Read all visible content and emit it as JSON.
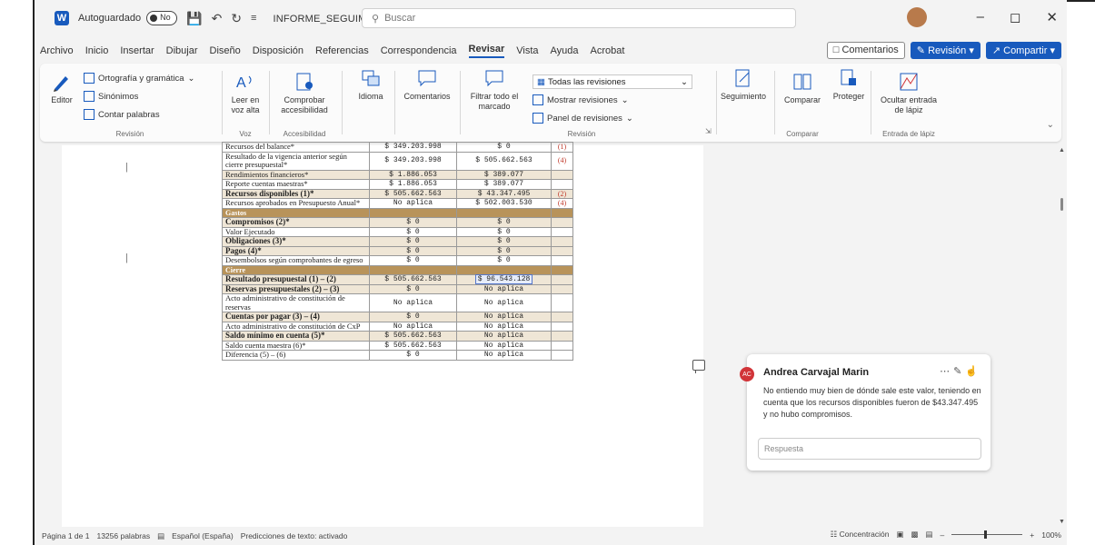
{
  "titlebar": {
    "autosave_label": "Autoguardado",
    "autosave_state": "No",
    "doc_title": "INFORME_SEGUIMIENTO_LA_MACARENA_V... ∨",
    "search_placeholder": "Buscar"
  },
  "menu": {
    "items": [
      "Archivo",
      "Inicio",
      "Insertar",
      "Dibujar",
      "Diseño",
      "Disposición",
      "Referencias",
      "Correspondencia",
      "Revisar",
      "Vista",
      "Ayuda",
      "Acrobat"
    ],
    "comentarios": "Comentarios",
    "revision": "Revisión",
    "compartir": "Compartir"
  },
  "ribbon": {
    "editor": "Editor",
    "ortografia": "Ortografía y gramática",
    "sinonimos": "Sinónimos",
    "contar": "Contar palabras",
    "group_revision": "Revisión",
    "leer": "Leer en voz alta",
    "group_voz": "Voz",
    "comprobar": "Comprobar accesibilidad",
    "group_accesibilidad": "Accesibilidad",
    "idioma": "Idioma",
    "comentarios": "Comentarios",
    "seguir": "Filtrar todo el marcado",
    "todas": "Todas las revisiones",
    "mostrar": "Mostrar revisiones",
    "panel": "Panel de revisiones",
    "group_seguimiento": "Revisión",
    "seguimiento": "Seguimiento",
    "comparar": "Comparar",
    "group_comparar": "Comparar",
    "proteger": "Proteger",
    "ocultar": "Ocultar entrada de lápiz",
    "group_lapiz": "Entrada de lápiz"
  },
  "table": {
    "rows": [
      {
        "label": "Recursos del balance*",
        "v1": "$ 349.203.998",
        "v2": "$ 0",
        "note": "(1)",
        "style": "partial"
      },
      {
        "label": "Resultado de la vigencia anterior según cierre presupuestal*",
        "v1": "$ 349.203.998",
        "v2": "$ 505.662.563",
        "note": "(4)",
        "style": "plain"
      },
      {
        "label": "Rendimientos financieros*",
        "v1": "$ 1.886.053",
        "v2": "$ 389.077",
        "note": "",
        "style": "shade"
      },
      {
        "label": "Reporte cuentas maestras*",
        "v1": "$ 1.886.053",
        "v2": "$ 389.077",
        "note": "",
        "style": "plain"
      },
      {
        "label": "Recursos disponibles (1)*",
        "v1": "$ 505.662.563",
        "v2": "$ 43.347.495",
        "note": "(2)",
        "style": "shade",
        "bold": true
      },
      {
        "label": "Recursos aprobados en Presupuesto Anual*",
        "v1": "No aplica",
        "v2": "$ 502.003.530",
        "note": "(4)",
        "style": "plain"
      },
      {
        "label": "Gastos",
        "style": "sec"
      },
      {
        "label": "Compromisos (2)*",
        "v1": "$ 0",
        "v2": "$ 0",
        "note": "",
        "style": "shade",
        "bold": true
      },
      {
        "label": "Valor Ejecutado",
        "v1": "$ 0",
        "v2": "$ 0",
        "note": "",
        "style": "plain"
      },
      {
        "label": "Obligaciones (3)*",
        "v1": "$ 0",
        "v2": "$ 0",
        "note": "",
        "style": "shade",
        "bold": true
      },
      {
        "label": "Pagos (4)*",
        "v1": "$ 0",
        "v2": "$ 0",
        "note": "",
        "style": "shade",
        "bold": true
      },
      {
        "label": "Desembolsos según comprobantes de egreso",
        "v1": "$ 0",
        "v2": "$ 0",
        "note": "",
        "style": "plain"
      },
      {
        "label": "Cierre",
        "style": "sec"
      },
      {
        "label": "Resultado presupuestal (1) – (2)",
        "v1": "$ 505.662.563",
        "v2": "$ 96.543.128",
        "note": "",
        "style": "shade",
        "bold": true,
        "selected": true
      },
      {
        "label": "Reservas presupuestales (2) – (3)",
        "v1": "$ 0",
        "v2": "No aplica",
        "note": "",
        "style": "shade",
        "bold": true
      },
      {
        "label": "Acto administrativo de constitución de reservas",
        "v1": "No aplica",
        "v2": "No aplica",
        "note": "",
        "style": "plain"
      },
      {
        "label": "Cuentas por pagar (3) – (4)",
        "v1": "$ 0",
        "v2": "No aplica",
        "note": "",
        "style": "shade",
        "bold": true
      },
      {
        "label": "Acto administrativo de constitución de CxP",
        "v1": "No aplica",
        "v2": "No aplica",
        "note": "",
        "style": "plain"
      },
      {
        "label": "Saldo mínimo en cuenta (5)*",
        "v1": "$ 505.662.563",
        "v2": "No aplica",
        "note": "",
        "style": "shade",
        "bold": true
      },
      {
        "label": "Saldo cuenta maestra (6)*",
        "v1": "$ 505.662.563",
        "v2": "No aplica",
        "note": "",
        "style": "plain"
      },
      {
        "label": "Diferencia (5) – (6)",
        "v1": "$ 0",
        "v2": "No aplica",
        "note": "",
        "style": "plain"
      }
    ]
  },
  "comment": {
    "initials": "AC",
    "author": "Andrea Carvajal Marin",
    "text": "No entiendo muy bien de dónde sale este valor, teniendo en cuenta que los recursos disponibles fueron de $43.347.495 y no hubo compromisos.",
    "reply_placeholder": "Respuesta"
  },
  "status": {
    "page": "Página 1 de 1",
    "words": "13256 palabras",
    "language": "Español (España)",
    "prediction": "Predicciones de texto: activado",
    "focus": "Concentración",
    "zoom": "100%"
  },
  "colors": {
    "accent": "#185abd",
    "table_section": "#b8935a",
    "table_shade": "#efe6d6",
    "comment_avatar": "#d13438"
  }
}
